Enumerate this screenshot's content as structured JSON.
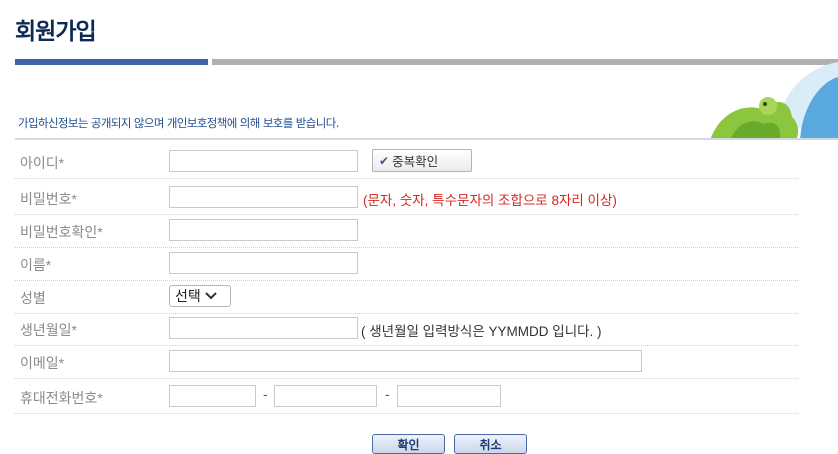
{
  "page": {
    "title": "회원가입",
    "notice": "가입하신정보는 공개되지 않으며 개인보호정책에 의해 보호를 받습니다."
  },
  "form": {
    "id_label": "아이디*",
    "dup_check_label": "중복확인",
    "password_label": "비밀번호*",
    "password_hint": "(문자, 숫자, 특수문자의 조합으로 8자리 이상)",
    "password_confirm_label": "비밀번호확인*",
    "name_label": "이름*",
    "gender_label": "성별",
    "gender_selected": "선택",
    "birth_label": "생년월일*",
    "birth_hint": "( 생년월일 입력방식은 YYMMDD 입니다. )",
    "email_label": "이메일*",
    "phone_label": "휴대전화번호*",
    "phone_separator": "-"
  },
  "footer": {
    "confirm_label": "확인",
    "cancel_label": "취소"
  },
  "icons": {
    "check": "check-icon",
    "dropdown": "chevron-down-icon",
    "banner": "mascot-illustration"
  },
  "colors": {
    "title": "#0d2a55",
    "accent_bar": "#3f63a8",
    "hint_red": "#d7261e"
  }
}
